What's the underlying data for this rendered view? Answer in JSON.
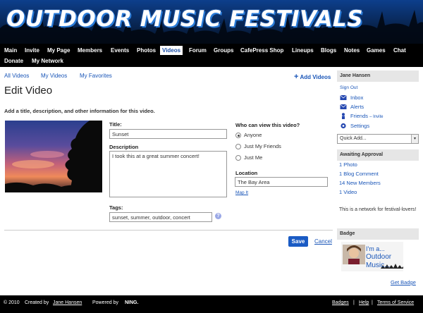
{
  "site": {
    "title": "OUTDOOR MUSIC FESTIVALS"
  },
  "nav": [
    "Main",
    "Invite",
    "My Page",
    "Members",
    "Events",
    "Photos",
    "Videos",
    "Forum",
    "Groups",
    "CafePress Shop",
    "Lineups",
    "Blogs",
    "Notes",
    "Games",
    "Chat",
    "Donate",
    "My Network"
  ],
  "nav_active": "Videos",
  "subtabs": [
    "All Videos",
    "My Videos",
    "My Favorites"
  ],
  "add_videos": "Add Videos",
  "page_title": "Edit Video",
  "intro": "Add a title, description, and other information for this video.",
  "form": {
    "title_label": "Title:",
    "title_value": "Sunset",
    "description_label": "Description",
    "description_value": "I took this at a great summer concert!",
    "tags_label": "Tags:",
    "tags_value": "sunset, summer, outdoor, concert",
    "help_icon": "?",
    "privacy_label": "Who can view this video?",
    "privacy_options": [
      "Anyone",
      "Just My Friends",
      "Just Me"
    ],
    "privacy_selected": "Anyone",
    "location_label": "Location",
    "location_value": "The Bay Area",
    "map_it": "Map It",
    "save": "Save",
    "cancel": "Cancel"
  },
  "sidebar": {
    "user_name": "Jane Hansen",
    "sign_out": "Sign Out",
    "inbox": "Inbox",
    "alerts": "Alerts",
    "friends": "Friends",
    "invite": "– Invite",
    "settings": "Settings",
    "quick_add": "Quick Add...",
    "awaiting_approval": "Awaiting Approval",
    "approvals": [
      "1 Photo",
      "1 Blog Comment",
      "14 New Members",
      "1 Video"
    ],
    "network_desc": "This is a network for festival-lovers!",
    "badge_header": "Badge",
    "badge_lines": [
      "I'm a...",
      "Outdoor",
      "Music..."
    ],
    "get_badge": "Get Badge"
  },
  "footer": {
    "copyright": "© 2010",
    "created_by": "Created by",
    "creator": "Jane Hansen",
    "powered_by": "Powered by",
    "ning": "NING.",
    "badges": "Badges",
    "sep": "|",
    "help": "Help",
    "terms": "Terms of Service"
  },
  "colors": {
    "link": "#1a56b8",
    "save_button": "#1a5bc4",
    "header_bg": "#000000"
  },
  "icons": [
    "inbox-icon",
    "alerts-icon",
    "friends-icon",
    "settings-icon",
    "plus-icon",
    "help-icon",
    "dropdown-arrow-icon"
  ]
}
